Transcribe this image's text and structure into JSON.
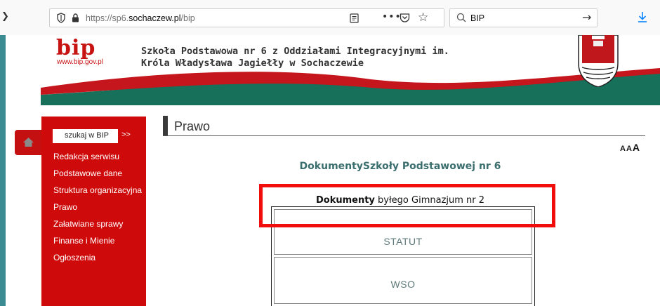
{
  "browser": {
    "url_prefix": "https://sp6.",
    "url_domain": "sochaczew.pl",
    "url_path": "/bip",
    "page_actions_dots": "•••",
    "search_value": "BIP",
    "go_arrow": "→",
    "back_chevron": "❯"
  },
  "header": {
    "logo_text": "bip",
    "logo_url": "www.bip.gov.pl",
    "school_line1": "Szkoła Podstawowa nr 6 z Oddziałami Integracyjnymi im.",
    "school_line2": "Króla Władysława Jagiełły w Sochaczewie"
  },
  "sidebar": {
    "search_label": "szukaj w BIP",
    "search_go": ">>",
    "items": [
      {
        "label": "Redakcja serwisu"
      },
      {
        "label": "Podstawowe dane"
      },
      {
        "label": "Struktura organizacyjna"
      },
      {
        "label": "Prawo"
      },
      {
        "label": "Załatwiane sprawy"
      },
      {
        "label": "Finanse i Mienie"
      },
      {
        "label": "Ogłoszenia"
      }
    ]
  },
  "main": {
    "title": "Prawo",
    "font_small": "A",
    "font_medium": "A",
    "font_large": "A",
    "documents_heading": "DokumentySzkoły Podstawowej nr 6",
    "gim_heading_bold": "Dokumenty",
    "gim_heading_rest": " byłego Gimnazjum nr 2",
    "docs": [
      {
        "label": "STATUT"
      },
      {
        "label": "WSO"
      }
    ]
  },
  "colors": {
    "brand_red": "#cf0a0a",
    "highlight_red": "#f20d0d",
    "teal": "#3b8c92",
    "heading_teal": "#3b6e6e"
  }
}
